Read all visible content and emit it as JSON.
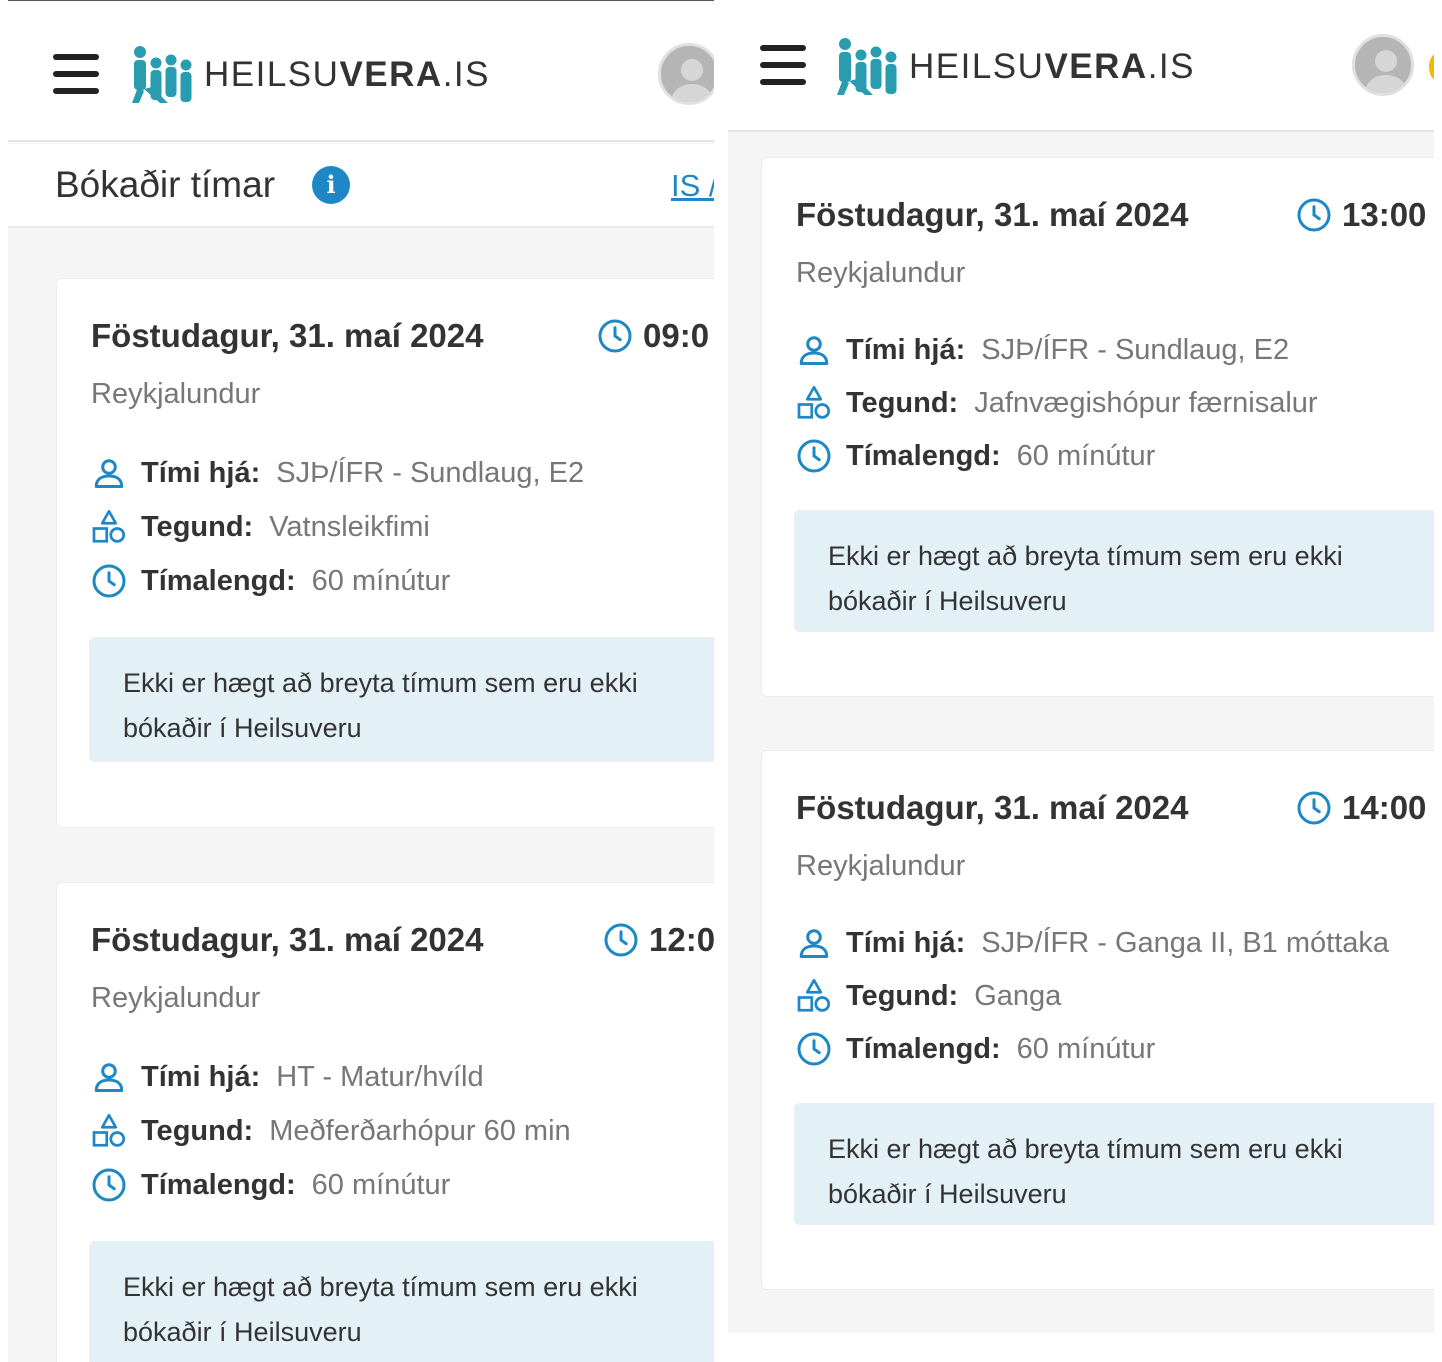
{
  "app": {
    "logo_text_pre": "HEILSU",
    "logo_text_mid": "VERA",
    "logo_text_post": ".IS",
    "page_title": "Bókaðir tímar",
    "lang_link": "IS /",
    "info_icon": "i"
  },
  "labels": {
    "provider": "Tími hjá:",
    "type": "Tegund:",
    "duration": "Tímalengd:",
    "notice": "Ekki er hægt að breyta tímum sem eru ekki bókaðir í Heilsuveru"
  },
  "icons": [
    "menu-icon",
    "logo-icon",
    "avatar-icon",
    "info-icon",
    "clock-icon",
    "person-icon",
    "shapes-icon"
  ],
  "colors": {
    "accent": "#1e88c7",
    "logo": "#2a9cb0",
    "notice_bg": "#e3f1f7",
    "page_bg": "#f5f5f5"
  },
  "left": {
    "appointments": [
      {
        "date": "Föstudagur, 31. maí 2024",
        "time": "09:0",
        "location": "Reykjalundur",
        "provider": "SJÞ/ÍFR - Sundlaug, E2",
        "type": "Vatnsleikfimi",
        "duration": "60 mínútur"
      },
      {
        "date": "Föstudagur, 31. maí 2024",
        "time": "12:0",
        "location": "Reykjalundur",
        "provider": "HT - Matur/hvíld",
        "type": "Meðferðarhópur 60 min",
        "duration": "60 mínútur"
      }
    ]
  },
  "right": {
    "appointments": [
      {
        "date": "Föstudagur, 31. maí 2024",
        "time": "13:00",
        "location": "Reykjalundur",
        "provider": "SJÞ/ÍFR - Sundlaug, E2",
        "type": "Jafnvægishópur færnisalur",
        "duration": "60 mínútur"
      },
      {
        "date": "Föstudagur, 31. maí 2024",
        "time": "14:00",
        "location": "Reykjalundur",
        "provider": "SJÞ/ÍFR - Ganga II, B1 móttaka",
        "type": "Ganga",
        "duration": "60 mínútur"
      }
    ]
  }
}
